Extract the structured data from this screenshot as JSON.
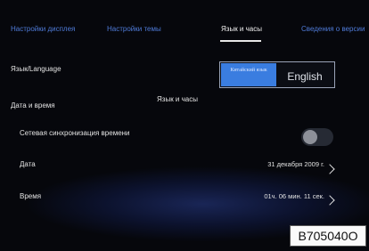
{
  "tabs": [
    {
      "label": "Настройки дисплея"
    },
    {
      "label": "Настройки темы"
    },
    {
      "label": "Язык и часы",
      "active": true
    },
    {
      "label": "Сведения о версии"
    }
  ],
  "language": {
    "label": "Язык/Language",
    "options": [
      "Китайский язык",
      "English"
    ],
    "selected": "Китайский язык"
  },
  "datetime": {
    "section_label": "Дата и время",
    "section_caption": "Язык и часы",
    "network_sync": {
      "label": "Сетевая синхронизация времени",
      "enabled": false
    },
    "date": {
      "label": "Дата",
      "value": "31 декабря 2009 г."
    },
    "time": {
      "label": "Время",
      "value": "01ч. 06 мин. 11 сек."
    }
  },
  "watermark": "B705040O",
  "colors": {
    "accent": "#3a7de0",
    "tab_inactive": "#4f7bd8",
    "background": "#06070c"
  }
}
